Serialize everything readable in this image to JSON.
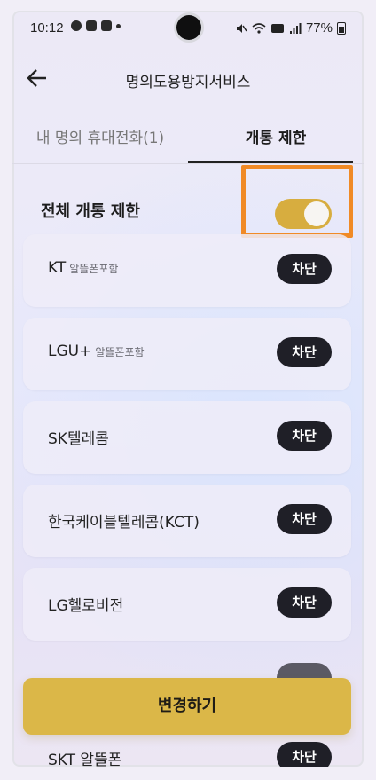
{
  "status_bar": {
    "time": "10:12",
    "battery": "77%",
    "icons": [
      "chat-icon",
      "gallery-icon",
      "mail-icon",
      "dot-icon",
      "mute-icon",
      "wifi-icon",
      "volte-icon",
      "signal-icon",
      "battery-icon"
    ]
  },
  "header": {
    "title": "명의도용방지서비스",
    "back_icon": "back-arrow-icon"
  },
  "tabs": [
    {
      "label": "내 명의 휴대전화(1)",
      "active": false
    },
    {
      "label": "개통 제한",
      "active": true
    }
  ],
  "master_toggle": {
    "label": "전체 개통 제한",
    "state": "on"
  },
  "carriers": [
    {
      "name": "KT",
      "sub": "알뜰폰포함",
      "button": "차단"
    },
    {
      "name": "LGU+",
      "sub": "알뜰폰포함",
      "button": "차단"
    },
    {
      "name": "SK텔레콤",
      "sub": "",
      "button": "차단"
    },
    {
      "name": "한국케이블텔레콤(KCT)",
      "sub": "",
      "button": "차단"
    },
    {
      "name": "LG헬로비전",
      "sub": "",
      "button": "차단"
    }
  ],
  "cta": {
    "label": "변경하기"
  },
  "partial_row": {
    "name": "SKT 알뜰폰",
    "button": "차단"
  },
  "colors": {
    "accent_toggle": "#d7ad3f",
    "cta": "#dbb748",
    "block_button": "#1f1f27",
    "highlight": "#f08a26"
  }
}
